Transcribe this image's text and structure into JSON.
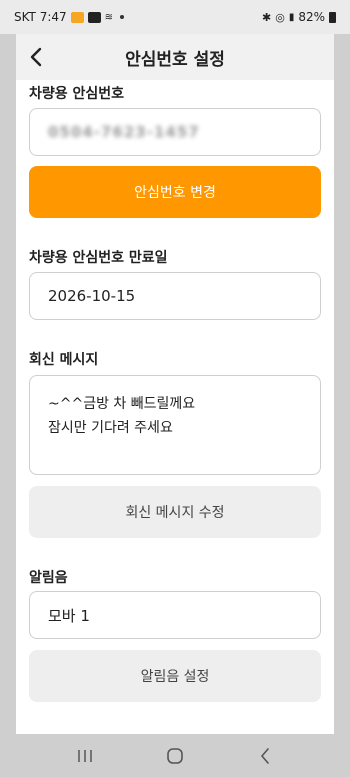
{
  "status_bar": {
    "carrier_time": "SKT 7:47",
    "battery": "82%"
  },
  "header": {
    "title": "안심번호 설정",
    "back_icon": "chevron-left-icon"
  },
  "safe_number": {
    "label": "차량용 안심번호",
    "value": "0504-7623-1457",
    "change_button": "안심번호 변경"
  },
  "expiry": {
    "label": "차량용 안심번호 만료일",
    "value": "2026-10-15"
  },
  "reply": {
    "label": "회신 메시지",
    "line1": "~^^금방 차 빼드릴께요",
    "line2": "잠시만 기다려 주세요",
    "edit_button": "회신 메시지 수정"
  },
  "ringtone": {
    "label": "알림음",
    "value": "모바 1",
    "set_button": "알림음 설정"
  },
  "colors": {
    "accent": "#ff9800",
    "gray_button": "#eeeeee"
  }
}
